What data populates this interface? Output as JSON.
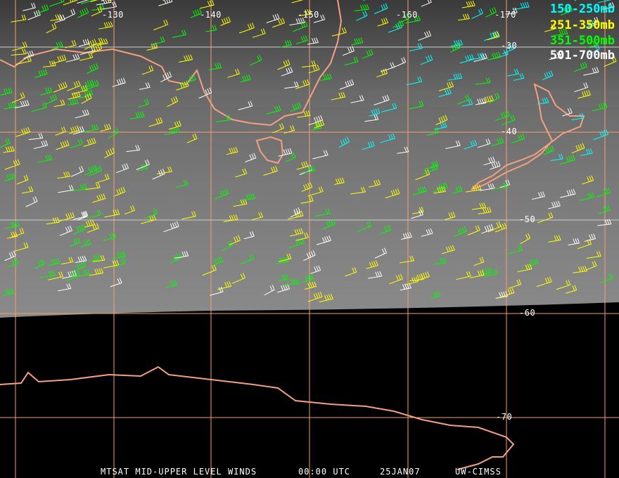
{
  "map": {
    "longitude_labels": [
      "-130",
      "-140",
      "-150",
      "-160",
      "-170"
    ],
    "latitude_labels": [
      "-30",
      "-40",
      "-50",
      "-60",
      "-70"
    ],
    "grid_color": "#f4a070",
    "coast_color": "#f4a080"
  },
  "legend": [
    {
      "label": "150-250mb",
      "color": "#00ffff"
    },
    {
      "label": "251-350mb",
      "color": "#ffff00"
    },
    {
      "label": "351-500mb",
      "color": "#00ff00"
    },
    {
      "label": "501-700mb",
      "color": "#ffffff"
    }
  ],
  "caption": {
    "title": "MTSAT MID-UPPER LEVEL WINDS",
    "time": "00:00 UTC",
    "date": "25JAN07",
    "source": "UW-CIMSS"
  }
}
